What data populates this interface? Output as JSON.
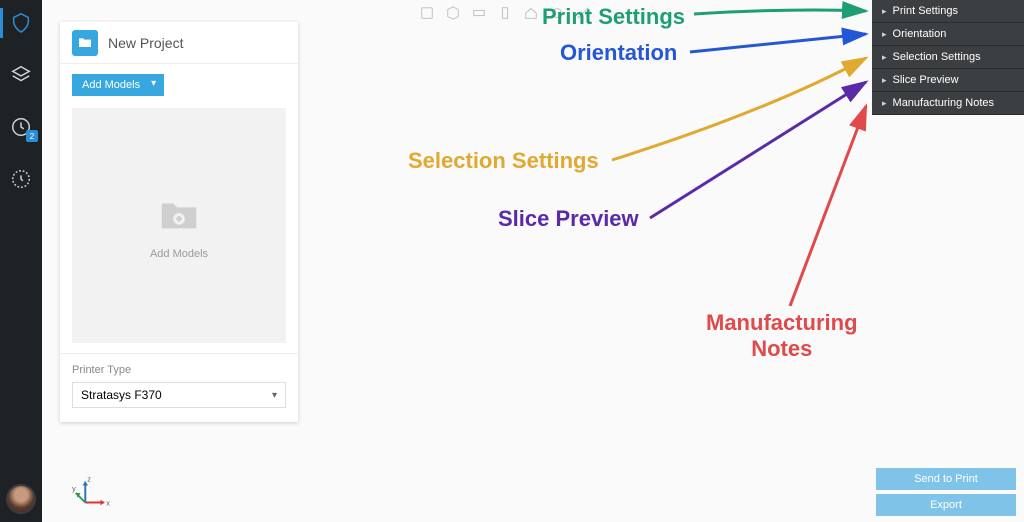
{
  "rail": {
    "queue_badge": "2"
  },
  "project": {
    "title": "New Project",
    "add_models_button": "Add Models",
    "drop_hint": "Add Models",
    "printer_label": "Printer Type",
    "printer_value": "Stratasys F370"
  },
  "accordion": {
    "items": [
      {
        "label": "Print Settings"
      },
      {
        "label": "Orientation"
      },
      {
        "label": "Selection Settings"
      },
      {
        "label": "Slice Preview"
      },
      {
        "label": "Manufacturing Notes"
      }
    ]
  },
  "buttons": {
    "send": "Send to Print",
    "export": "Export"
  },
  "annotations": {
    "print_settings": "Print Settings",
    "orientation": "Orientation",
    "selection_settings": "Selection Settings",
    "slice_preview": "Slice Preview",
    "manufacturing_notes": "Manufacturing\nNotes"
  },
  "axes": {
    "x": "x",
    "y": "y",
    "z": "z"
  }
}
